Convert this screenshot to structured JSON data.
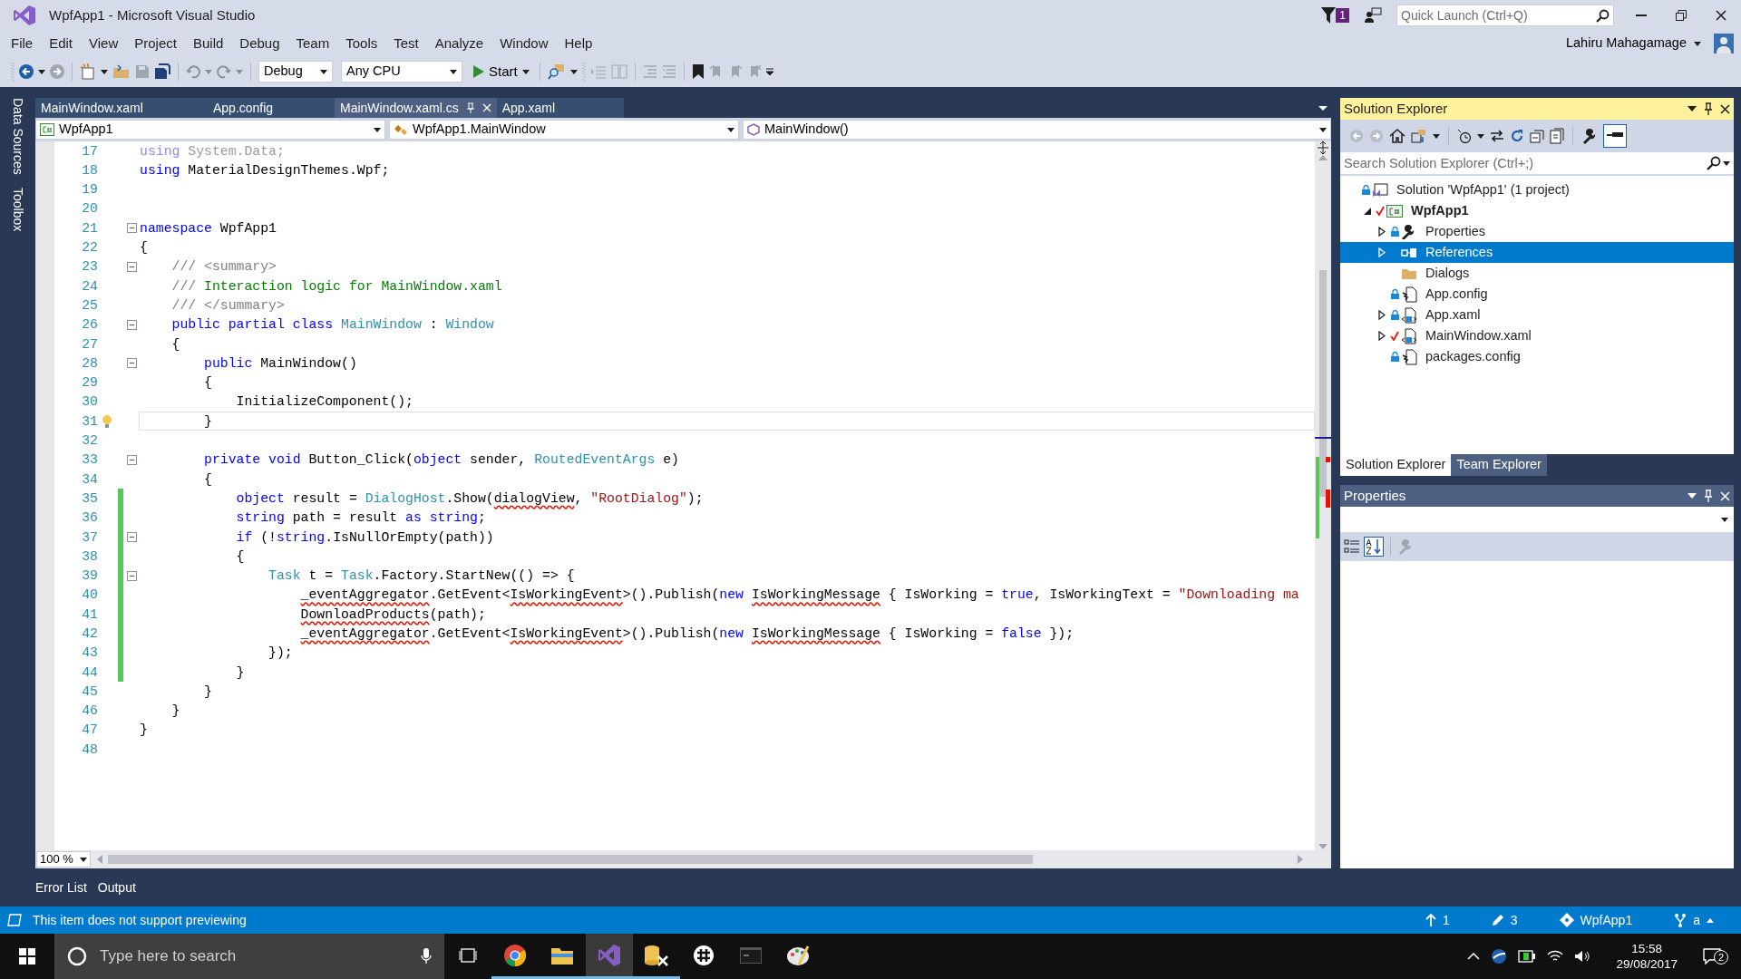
{
  "window": {
    "title": "WpfApp1 - Microsoft Visual Studio",
    "notification_count": "1",
    "quick_launch": {
      "placeholder": "Quick Launch (Ctrl+Q)"
    },
    "user": "Lahiru Mahagamage"
  },
  "menu": [
    "File",
    "Edit",
    "View",
    "Project",
    "Build",
    "Debug",
    "Team",
    "Tools",
    "Test",
    "Analyze",
    "Window",
    "Help"
  ],
  "toolbar": {
    "configuration": "Debug",
    "platform": "Any CPU",
    "start": "Start"
  },
  "side_tabs": [
    "Data Sources",
    "Toolbox"
  ],
  "document_tabs": [
    {
      "label": "MainWindow.xaml",
      "selected": false
    },
    {
      "label": "App.config",
      "selected": false
    },
    {
      "label": "MainWindow.xaml.cs",
      "selected": true
    },
    {
      "label": "App.xaml",
      "selected": false
    }
  ],
  "navigation_bar": [
    {
      "kind": "project",
      "text": "WpfApp1"
    },
    {
      "kind": "class",
      "text": "WpfApp1.MainWindow"
    },
    {
      "kind": "method",
      "text": "MainWindow()"
    }
  ],
  "code_lines": [
    {
      "number": "17",
      "changed": false,
      "current": false,
      "fold": false,
      "tokens": [
        {
          "kind": "faded_kw",
          "text": "using"
        },
        {
          "kind": "faded",
          "text": " System.Data;"
        }
      ]
    },
    {
      "number": "18",
      "changed": false,
      "current": false,
      "fold": false,
      "tokens": [
        {
          "kind": "kw",
          "text": "using"
        },
        {
          "kind": "plain",
          "text": " MaterialDesignThemes.Wpf;"
        }
      ]
    },
    {
      "number": "19",
      "changed": false,
      "current": false,
      "fold": false
    },
    {
      "number": "20",
      "changed": false,
      "current": false,
      "fold": false
    },
    {
      "number": "21",
      "changed": false,
      "current": false,
      "fold": true,
      "tokens": [
        {
          "kind": "kw",
          "text": "namespace"
        },
        {
          "kind": "plain",
          "text": " WpfApp1"
        }
      ]
    },
    {
      "number": "22",
      "changed": false,
      "current": false,
      "fold": false,
      "tokens": [
        {
          "kind": "plain",
          "text": "{"
        }
      ]
    },
    {
      "number": "23",
      "changed": false,
      "current": false,
      "fold": true,
      "tokens": [
        {
          "kind": "comment",
          "text": "    /// <summary>"
        }
      ]
    },
    {
      "number": "24",
      "changed": false,
      "current": false,
      "fold": false,
      "tokens": [
        {
          "kind": "comment",
          "text": "    ///"
        },
        {
          "kind": "doc",
          "text": " Interaction logic for MainWindow.xaml"
        }
      ]
    },
    {
      "number": "25",
      "changed": false,
      "current": false,
      "fold": false,
      "tokens": [
        {
          "kind": "comment",
          "text": "    /// </summary>"
        }
      ]
    },
    {
      "number": "26",
      "changed": false,
      "current": false,
      "fold": true,
      "tokens": [
        {
          "kind": "kw",
          "text": "    public partial class "
        },
        {
          "kind": "type",
          "text": "MainWindow"
        },
        {
          "kind": "plain",
          "text": " : "
        },
        {
          "kind": "type",
          "text": "Window"
        }
      ]
    },
    {
      "number": "27",
      "changed": false,
      "current": false,
      "fold": false,
      "tokens": [
        {
          "kind": "plain",
          "text": "    {"
        }
      ]
    },
    {
      "number": "28",
      "changed": false,
      "current": false,
      "fold": true,
      "tokens": [
        {
          "kind": "kw",
          "text": "        public"
        },
        {
          "kind": "plain",
          "text": " MainWindow()"
        }
      ]
    },
    {
      "number": "29",
      "changed": false,
      "current": false,
      "fold": false,
      "tokens": [
        {
          "kind": "plain",
          "text": "        {"
        }
      ]
    },
    {
      "number": "30",
      "changed": false,
      "current": false,
      "fold": false,
      "tokens": [
        {
          "kind": "plain",
          "text": "            InitializeComponent();"
        }
      ]
    },
    {
      "number": "31",
      "changed": false,
      "current": true,
      "fold": false,
      "tokens": [
        {
          "kind": "plain",
          "text": "        }"
        }
      ]
    },
    {
      "number": "32",
      "changed": false,
      "current": false,
      "fold": false
    },
    {
      "number": "33",
      "changed": false,
      "current": false,
      "fold": true,
      "tokens": [
        {
          "kind": "kw",
          "text": "        private void"
        },
        {
          "kind": "plain",
          "text": " Button_Click("
        },
        {
          "kind": "kw",
          "text": "object"
        },
        {
          "kind": "plain",
          "text": " sender, "
        },
        {
          "kind": "type",
          "text": "RoutedEventArgs"
        },
        {
          "kind": "plain",
          "text": " e)"
        }
      ]
    },
    {
      "number": "34",
      "changed": false,
      "current": false,
      "fold": false,
      "tokens": [
        {
          "kind": "plain",
          "text": "        {"
        }
      ]
    },
    {
      "number": "35",
      "changed": true,
      "current": false,
      "fold": false,
      "tokens": [
        {
          "kind": "kw",
          "text": "            object"
        },
        {
          "kind": "plain",
          "text": " result = "
        },
        {
          "kind": "type",
          "text": "DialogHost"
        },
        {
          "kind": "plain",
          "text": ".Show("
        },
        {
          "kind": "error",
          "text": "dialogView"
        },
        {
          "kind": "plain",
          "text": ", "
        },
        {
          "kind": "str",
          "text": "\"RootDialog\""
        },
        {
          "kind": "plain",
          "text": ");"
        }
      ]
    },
    {
      "number": "36",
      "changed": true,
      "current": false,
      "fold": false,
      "tokens": [
        {
          "kind": "kw",
          "text": "            string"
        },
        {
          "kind": "plain",
          "text": " path = result "
        },
        {
          "kind": "kw",
          "text": "as string"
        },
        {
          "kind": "plain",
          "text": ";"
        }
      ]
    },
    {
      "number": "37",
      "changed": true,
      "current": false,
      "fold": true,
      "tokens": [
        {
          "kind": "kw",
          "text": "            if"
        },
        {
          "kind": "plain",
          "text": " (!"
        },
        {
          "kind": "kw",
          "text": "string"
        },
        {
          "kind": "plain",
          "text": ".IsNullOrEmpty(path))"
        }
      ]
    },
    {
      "number": "38",
      "changed": true,
      "current": false,
      "fold": false,
      "tokens": [
        {
          "kind": "plain",
          "text": "            {"
        }
      ]
    },
    {
      "number": "39",
      "changed": true,
      "current": false,
      "fold": true,
      "tokens": [
        {
          "kind": "type",
          "text": "                Task"
        },
        {
          "kind": "plain",
          "text": " t = "
        },
        {
          "kind": "type",
          "text": "Task"
        },
        {
          "kind": "plain",
          "text": ".Factory.StartNew(() => {"
        }
      ]
    },
    {
      "number": "40",
      "changed": true,
      "current": false,
      "fold": false,
      "tokens": [
        {
          "kind": "error",
          "text": "                    _eventAggregator"
        },
        {
          "kind": "plain",
          "text": ".GetEvent<"
        },
        {
          "kind": "error",
          "text": "IsWorkingEvent"
        },
        {
          "kind": "plain",
          "text": ">().Publish("
        },
        {
          "kind": "kw",
          "text": "new "
        },
        {
          "kind": "error",
          "text": "IsWorkingMessage"
        },
        {
          "kind": "plain",
          "text": " { IsWorking = "
        },
        {
          "kind": "kw",
          "text": "true"
        },
        {
          "kind": "plain",
          "text": ", IsWorkingText = "
        },
        {
          "kind": "str",
          "text": "\"Downloading ma"
        }
      ]
    },
    {
      "number": "41",
      "changed": true,
      "current": false,
      "fold": false,
      "tokens": [
        {
          "kind": "error",
          "text": "                    DownloadProducts"
        },
        {
          "kind": "plain",
          "text": "(path);"
        }
      ]
    },
    {
      "number": "42",
      "changed": true,
      "current": false,
      "fold": false,
      "tokens": [
        {
          "kind": "error",
          "text": "                    _eventAggregator"
        },
        {
          "kind": "plain",
          "text": ".GetEvent<"
        },
        {
          "kind": "error",
          "text": "IsWorkingEvent"
        },
        {
          "kind": "plain",
          "text": ">().Publish("
        },
        {
          "kind": "kw",
          "text": "new "
        },
        {
          "kind": "error",
          "text": "IsWorkingMessage"
        },
        {
          "kind": "plain",
          "text": " { IsWorking = "
        },
        {
          "kind": "kw",
          "text": "false"
        },
        {
          "kind": "plain",
          "text": " });"
        }
      ]
    },
    {
      "number": "43",
      "changed": true,
      "current": false,
      "fold": false,
      "tokens": [
        {
          "kind": "plain",
          "text": "                });"
        }
      ]
    },
    {
      "number": "44",
      "changed": true,
      "current": false,
      "fold": false,
      "tokens": [
        {
          "kind": "plain",
          "text": "            }"
        }
      ]
    },
    {
      "number": "45",
      "changed": false,
      "current": false,
      "fold": false,
      "tokens": [
        {
          "kind": "plain",
          "text": "        }"
        }
      ]
    },
    {
      "number": "46",
      "changed": false,
      "current": false,
      "fold": false,
      "tokens": [
        {
          "kind": "plain",
          "text": "    }"
        }
      ]
    },
    {
      "number": "47",
      "changed": false,
      "current": false,
      "fold": false,
      "tokens": [
        {
          "kind": "plain",
          "text": "}"
        }
      ]
    },
    {
      "number": "48",
      "changed": false,
      "current": false,
      "fold": false
    }
  ],
  "zoom": "100 %",
  "bottom_tabs": [
    "Error List",
    "Output"
  ],
  "solution_explorer": {
    "title": "Solution Explorer",
    "search": {
      "placeholder": "Search Solution Explorer (Ctrl+;)"
    },
    "tree": [
      {
        "label": "Solution 'WpfApp1' (1 project)",
        "kind": "solution",
        "locked": true,
        "checked_out": false,
        "selected": false,
        "children": [
          {
            "label": "WpfApp1",
            "kind": "project",
            "expanded": true,
            "locked": false,
            "checked_out": true,
            "selected": false,
            "children": [
              {
                "label": "Properties",
                "kind": "properties",
                "expanded": false,
                "locked": true,
                "checked_out": false,
                "selected": false
              },
              {
                "label": "References",
                "kind": "references",
                "expanded": false,
                "locked": false,
                "checked_out": false,
                "selected": true
              },
              {
                "label": "Dialogs",
                "kind": "folder",
                "locked": false,
                "checked_out": false,
                "selected": false
              },
              {
                "label": "App.config",
                "kind": "config",
                "locked": true,
                "checked_out": false,
                "selected": false
              },
              {
                "label": "App.xaml",
                "kind": "xaml",
                "expanded": false,
                "locked": true,
                "checked_out": false,
                "selected": false
              },
              {
                "label": "MainWindow.xaml",
                "kind": "xaml",
                "expanded": false,
                "locked": false,
                "checked_out": true,
                "selected": false
              },
              {
                "label": "packages.config",
                "kind": "config",
                "locked": true,
                "checked_out": false,
                "selected": false
              }
            ]
          }
        ]
      }
    ],
    "tabs": [
      {
        "label": "Solution Explorer",
        "selected": true
      },
      {
        "label": "Team Explorer",
        "selected": false
      }
    ]
  },
  "properties": {
    "title": "Properties"
  },
  "status_bar": {
    "message": "This item does not support previewing",
    "items": [
      {
        "kind": "up",
        "text": "1"
      },
      {
        "kind": "pencil",
        "text": "3"
      },
      {
        "kind": "repo",
        "text": "WpfApp1"
      },
      {
        "kind": "branch",
        "text": "a"
      }
    ]
  },
  "taskbar": {
    "search": {
      "placeholder": "Type here to search"
    },
    "apps": [
      {
        "kind": "chrome",
        "open": true,
        "selected": false
      },
      {
        "kind": "explorer",
        "open": true,
        "selected": false
      },
      {
        "kind": "vs",
        "open": true,
        "selected": true
      },
      {
        "kind": "database",
        "open": true,
        "selected": false
      },
      {
        "kind": "slack",
        "open": false,
        "selected": false
      },
      {
        "kind": "terminal",
        "open": false,
        "selected": false
      },
      {
        "kind": "paint",
        "open": false,
        "selected": false
      }
    ],
    "time": "15:58",
    "date": "29/08/2017",
    "notifications": "2"
  }
}
